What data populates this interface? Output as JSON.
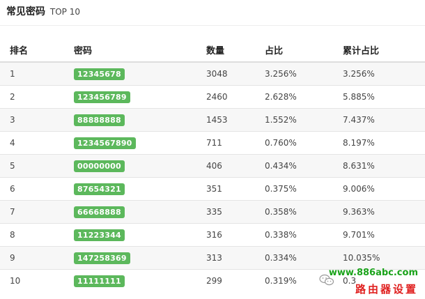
{
  "header": {
    "title": "常见密码",
    "subtitle": "TOP 10"
  },
  "table": {
    "columns": [
      "排名",
      "密码",
      "数量",
      "占比",
      "累计占比"
    ],
    "rows": [
      {
        "rank": "1",
        "password": "12345678",
        "count": "3048",
        "share": "3.256%",
        "cumulative": "3.256%"
      },
      {
        "rank": "2",
        "password": "123456789",
        "count": "2460",
        "share": "2.628%",
        "cumulative": "5.885%"
      },
      {
        "rank": "3",
        "password": "88888888",
        "count": "1453",
        "share": "1.552%",
        "cumulative": "7.437%"
      },
      {
        "rank": "4",
        "password": "1234567890",
        "count": "711",
        "share": "0.760%",
        "cumulative": "8.197%"
      },
      {
        "rank": "5",
        "password": "00000000",
        "count": "406",
        "share": "0.434%",
        "cumulative": "8.631%"
      },
      {
        "rank": "6",
        "password": "87654321",
        "count": "351",
        "share": "0.375%",
        "cumulative": "9.006%"
      },
      {
        "rank": "7",
        "password": "66668888",
        "count": "335",
        "share": "0.358%",
        "cumulative": "9.363%"
      },
      {
        "rank": "8",
        "password": "11223344",
        "count": "316",
        "share": "0.338%",
        "cumulative": "9.701%"
      },
      {
        "rank": "9",
        "password": "147258369",
        "count": "313",
        "share": "0.334%",
        "cumulative": "10.035%"
      },
      {
        "rank": "10",
        "password": "11111111",
        "count": "299",
        "share": "0.319%",
        "cumulative": "0.3"
      }
    ]
  },
  "watermark": {
    "url": "www.886abc.com",
    "name": "路由器设置",
    "icon": "wechat-icon"
  },
  "colors": {
    "badge": "#5cb85c",
    "row_alt": "#f7f7f7",
    "watermark_url": "#1aa31a",
    "watermark_name": "#e0201f"
  }
}
